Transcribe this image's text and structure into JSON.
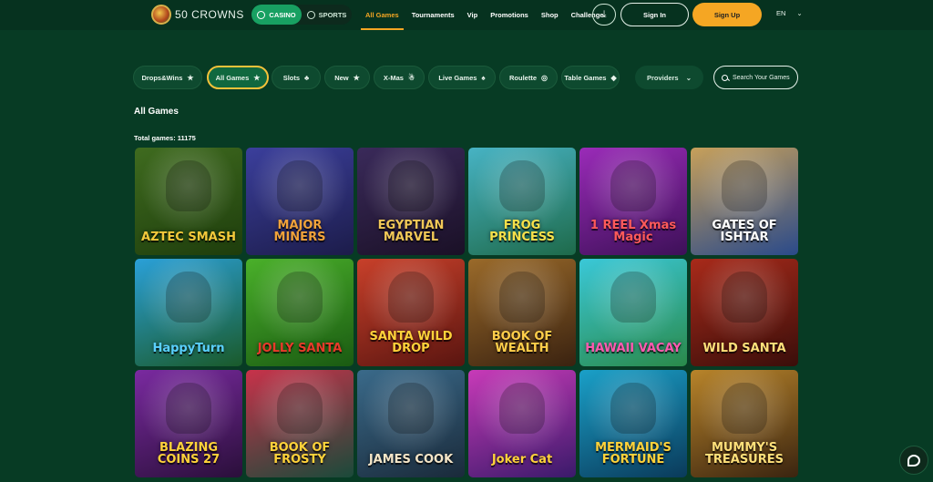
{
  "header": {
    "logo_text": "50 CROWNS",
    "segments": [
      {
        "label": "CASINO",
        "active": true,
        "icon": "spade-icon"
      },
      {
        "label": "SPORTS",
        "active": false,
        "icon": "soccer-ball-icon"
      }
    ],
    "nav": [
      {
        "label": "All Games",
        "active": true
      },
      {
        "label": "Tournaments",
        "active": false
      },
      {
        "label": "Vip",
        "active": false
      },
      {
        "label": "Promotions",
        "active": false
      },
      {
        "label": "Shop",
        "active": false
      },
      {
        "label": "Challenge",
        "active": false
      }
    ],
    "download_icon": "download-icon",
    "signin_label": "Sign In",
    "signup_label": "Sign Up",
    "language": "EN",
    "accent": "#f5a623"
  },
  "filters": {
    "pills": [
      {
        "label": "Drops&Wins",
        "icon": "★",
        "active": false
      },
      {
        "label": "All Games",
        "icon": "★",
        "active": true
      },
      {
        "label": "Slots",
        "icon": "♣",
        "active": false
      },
      {
        "label": "New",
        "icon": "★",
        "active": false
      },
      {
        "label": "X-Mas",
        "icon": "☃",
        "active": false
      },
      {
        "label": "Live Games",
        "icon": "♠",
        "active": false
      },
      {
        "label": "Roulette",
        "icon": "◎",
        "active": false
      },
      {
        "label": "Table Games",
        "icon": "◆",
        "active": false
      }
    ],
    "providers_label": "Providers",
    "search_placeholder": "Search Your Games"
  },
  "main": {
    "section_title": "All Games",
    "total_label": "Total games: 11175"
  },
  "games": [
    {
      "title": "AZTEC SMASH",
      "bg": "#3f6b1f",
      "bg2": "#1e3d0c",
      "color": "#f3c93b"
    },
    {
      "title": "MAJOR MINERS",
      "bg": "#3b3f9c",
      "bg2": "#1c1c4a",
      "color": "#f0a23a"
    },
    {
      "title": "EGYPTIAN MARVEL",
      "bg": "#3a2a5a",
      "bg2": "#1a1026",
      "color": "#f1c857"
    },
    {
      "title": "FROG PRINCESS",
      "bg": "#47b3c4",
      "bg2": "#1e6a4a",
      "color": "#f7e04a"
    },
    {
      "title": "1 REEL Xmas Magic",
      "bg": "#9a2bb8",
      "bg2": "#3d1058",
      "color": "#ff5a5a"
    },
    {
      "title": "GATES OF ISHTAR",
      "bg": "#c7a05a",
      "bg2": "#2a4a8a",
      "color": "#ffffff"
    },
    {
      "title": "HappyTurn",
      "bg": "#2aa0d8",
      "bg2": "#1a5a2a",
      "color": "#5ad0ff"
    },
    {
      "title": "JOLLY SANTA",
      "bg": "#4ab02a",
      "bg2": "#1a5a12",
      "color": "#e83a2a"
    },
    {
      "title": "SANTA WILD DROP",
      "bg": "#c8402a",
      "bg2": "#5a1510",
      "color": "#ffd23a"
    },
    {
      "title": "BOOK OF WEALTH",
      "bg": "#9a6a2a",
      "bg2": "#3a2210",
      "color": "#ffce4a"
    },
    {
      "title": "HAWAII VACAY",
      "bg": "#3ac8d8",
      "bg2": "#2a8a4a",
      "color": "#ff5ab0"
    },
    {
      "title": "WILD SANTA",
      "bg": "#a82a1a",
      "bg2": "#3a0e0a",
      "color": "#ffe07a"
    },
    {
      "title": "BLAZING COINS 27",
      "bg": "#7a2aa0",
      "bg2": "#2a0f3a",
      "color": "#ffd23a"
    },
    {
      "title": "BOOK OF FROSTY",
      "bg": "#c8324a",
      "bg2": "#1a4a3a",
      "color": "#ffd23a"
    },
    {
      "title": "JAMES COOK",
      "bg": "#3a6a8a",
      "bg2": "#1a2a3a",
      "color": "#f5e6c8"
    },
    {
      "title": "Joker Cat",
      "bg": "#c83ab8",
      "bg2": "#3a1a6a",
      "color": "#ffd23a"
    },
    {
      "title": "MERMAID'S FORTUNE",
      "bg": "#1aa0c8",
      "bg2": "#0a3a5a",
      "color": "#ffd23a"
    },
    {
      "title": "MUMMY'S TREASURES",
      "bg": "#b8842a",
      "bg2": "#3a2410",
      "color": "#ffe07a"
    }
  ],
  "chat_icon": "chat-icon"
}
